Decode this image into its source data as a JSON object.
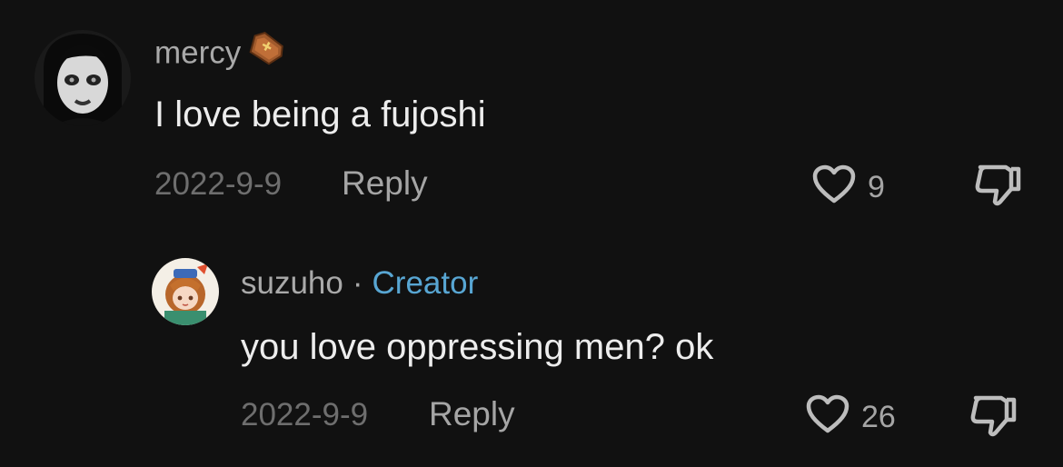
{
  "comments": [
    {
      "username": "mercy",
      "username_emoji": "coffin-emoji",
      "text": "I love being a fujoshi",
      "date": "2022-9-9",
      "reply_label": "Reply",
      "like_count": "9"
    }
  ],
  "replies": [
    {
      "username": "suzuho",
      "separator": "·",
      "badge": "Creator",
      "text": "you love oppressing men? ok",
      "date": "2022-9-9",
      "reply_label": "Reply",
      "like_count": "26"
    }
  ],
  "icons": {
    "like": "heart-outline-icon",
    "dislike": "thumbs-down-outline-icon"
  },
  "colors": {
    "background": "#111111",
    "creator_badge": "#58a6d3",
    "username": "#a9a9a9",
    "date": "#6e6e6e"
  }
}
